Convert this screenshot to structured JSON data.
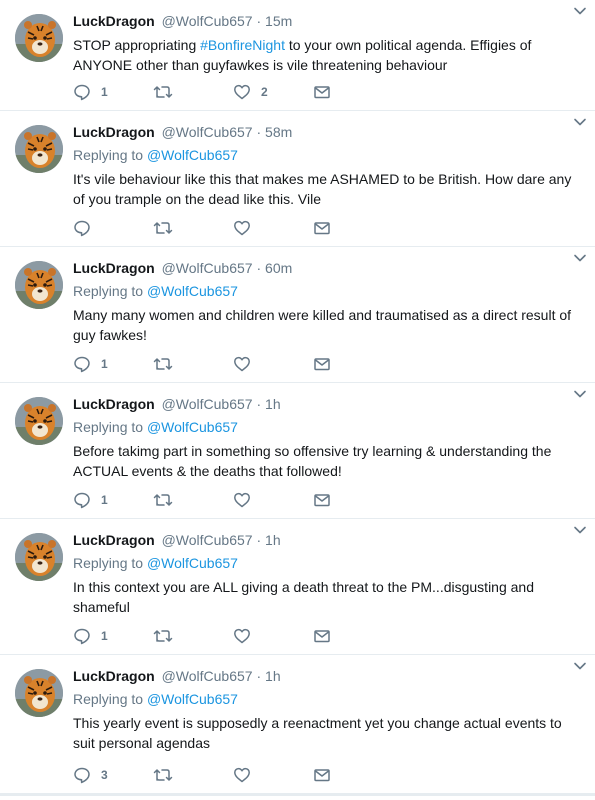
{
  "tweets": [
    {
      "name": "LuckDragon",
      "handle": "@WolfCub657",
      "separator": "·",
      "time": "15m",
      "reply_label": "",
      "reply_handle": "",
      "text_pre": "STOP appropriating ",
      "hashtag": "#BonfireNight",
      "text_post": " to your own political agenda. Effigies of ANYONE other than guyfawkes is vile threatening behaviour",
      "reply_count": "1",
      "retweet_count": "",
      "like_count": "2"
    },
    {
      "name": "LuckDragon",
      "handle": "@WolfCub657",
      "separator": "·",
      "time": "58m",
      "reply_label": "Replying to",
      "reply_handle": "@WolfCub657",
      "text": "It's vile behaviour like this that makes me ASHAMED to be British. How dare any of you trample on the dead like this. Vile",
      "reply_count": "",
      "retweet_count": "",
      "like_count": ""
    },
    {
      "name": "LuckDragon",
      "handle": "@WolfCub657",
      "separator": "·",
      "time": "60m",
      "reply_label": "Replying to",
      "reply_handle": "@WolfCub657",
      "text": "Many many women and children were killed and traumatised as a direct result of guy fawkes!",
      "reply_count": "1",
      "retweet_count": "",
      "like_count": ""
    },
    {
      "name": "LuckDragon",
      "handle": "@WolfCub657",
      "separator": "·",
      "time": "1h",
      "reply_label": "Replying to",
      "reply_handle": "@WolfCub657",
      "text": "Before takimg part in something so offensive try learning & understanding the ACTUAL events & the deaths that followed!",
      "reply_count": "1",
      "retweet_count": "",
      "like_count": ""
    },
    {
      "name": "LuckDragon",
      "handle": "@WolfCub657",
      "separator": "·",
      "time": "1h",
      "reply_label": "Replying to",
      "reply_handle": "@WolfCub657",
      "text": "In this context you are ALL giving a death threat to the PM...disgusting and shameful",
      "reply_count": "1",
      "retweet_count": "",
      "like_count": ""
    },
    {
      "name": "LuckDragon",
      "handle": "@WolfCub657",
      "separator": "·",
      "time": "1h",
      "reply_label": "Replying to",
      "reply_handle": "@WolfCub657",
      "text": "This yearly event is supposedly a reenactment yet you change actual events to suit personal agendas",
      "reply_count": "3",
      "retweet_count": "",
      "like_count": ""
    }
  ],
  "icons": {
    "reply": "reply-icon",
    "retweet": "retweet-icon",
    "like": "heart-icon",
    "message": "envelope-icon",
    "caret": "chevron-down-icon",
    "avatar": "tiger-avatar"
  },
  "colors": {
    "icon": "#657786",
    "link": "#1b95e0",
    "divider": "#e6ecf0"
  }
}
